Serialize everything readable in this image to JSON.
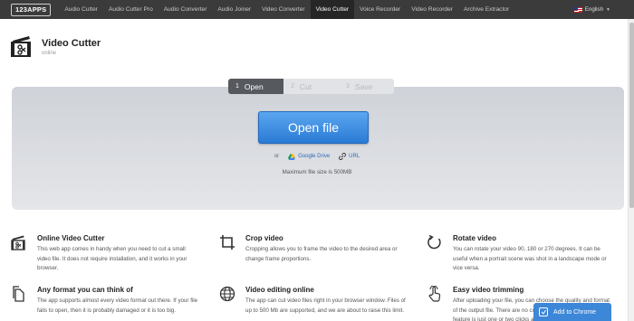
{
  "nav": {
    "logo": "123APPS",
    "items": [
      "Audio Cutter",
      "Audio Cutter Pro",
      "Audio Converter",
      "Audio Joiner",
      "Video Converter",
      "Video Cutter",
      "Voice Recorder",
      "Video Recorder",
      "Archive Extractor"
    ],
    "active_index": 5,
    "language": "English"
  },
  "app": {
    "title": "Video Cutter",
    "subtitle": "online"
  },
  "steps": [
    {
      "num": "1",
      "label": "Open"
    },
    {
      "num": "2",
      "label": "Cut"
    },
    {
      "num": "3",
      "label": "Save"
    }
  ],
  "open_button": "Open file",
  "sources": {
    "or": "or",
    "google_drive": "Google Drive",
    "url": "URL"
  },
  "max_size": "Maximum file size is 500MB",
  "features": [
    {
      "icon": "film-icon",
      "title": "Online Video Cutter",
      "text": "This web app comes in handy when you need to cut a small video file. It does not require installation, and it works in your browser."
    },
    {
      "icon": "crop-icon",
      "title": "Crop video",
      "text": "Cropping allows you to frame the video to the desired area or change frame proportions."
    },
    {
      "icon": "rotate-icon",
      "title": "Rotate video",
      "text": "You can rotate your video 90, 180 or 270 degrees. It can be useful when a portrait scene was shot in a landscape mode or vice versa."
    },
    {
      "icon": "copy-icon",
      "title": "Any format you can think of",
      "text": "The app supports almost every video format out there. If your file fails to open, then it is probably damaged or it is too big."
    },
    {
      "icon": "globe-icon",
      "title": "Video editing online",
      "text": "The app can cut video files right in your browser window. Files of up to 500 Mb are supported, and we are about to raise this limit."
    },
    {
      "icon": "hand-pointer-icon",
      "title": "Easy video trimming",
      "text": "After uploading your file, you can choose the quality and format of the output file. There are no complicated settings, and each feature is just one or two clicks away."
    }
  ],
  "chrome_button": "Add to Chrome",
  "colors": {
    "nav_bg": "#3b3b3b",
    "accent_blue": "#2a7bd6",
    "panel_bg": "#d6d8dc"
  }
}
